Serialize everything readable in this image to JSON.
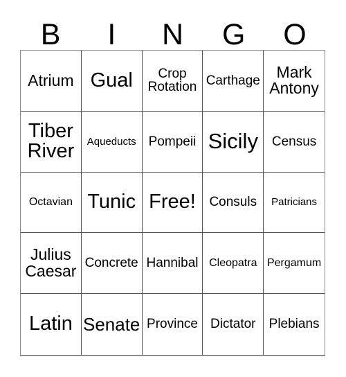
{
  "card": {
    "title_letters": [
      "B",
      "I",
      "N",
      "G",
      "O"
    ],
    "free_space_label": "Free!",
    "grid_line_color": "#555555",
    "border_color": "#8a8a8a",
    "text_color": "#000000",
    "background_color": "#ffffff",
    "columns": 5,
    "rows": 5,
    "cells": [
      {
        "text": "Atrium",
        "size": "sz-md"
      },
      {
        "text": "Gual",
        "size": "sz-lg"
      },
      {
        "text": "Crop Rotation",
        "size": "sz-sm"
      },
      {
        "text": "Carthage",
        "size": "sz-sm"
      },
      {
        "text": "Mark Antony",
        "size": "sz-md"
      },
      {
        "text": "Tiber River",
        "size": "sz-lg"
      },
      {
        "text": "Aqueducts",
        "size": "sz-xxs"
      },
      {
        "text": "Pompeii",
        "size": "sz-sm"
      },
      {
        "text": "Sicily",
        "size": "sz-xl"
      },
      {
        "text": "Census",
        "size": "sz-sm"
      },
      {
        "text": "Octavian",
        "size": "sz-xs"
      },
      {
        "text": "Tunic",
        "size": "sz-lg"
      },
      {
        "text": "Free!",
        "size": "sz-lg"
      },
      {
        "text": "Consuls",
        "size": "sz-sm"
      },
      {
        "text": "Patricians",
        "size": "sz-xxs"
      },
      {
        "text": "Julius Caesar",
        "size": "sz-md"
      },
      {
        "text": "Concrete",
        "size": "sz-sm"
      },
      {
        "text": "Hannibal",
        "size": "sz-sm"
      },
      {
        "text": "Cleopatra",
        "size": "sz-xs"
      },
      {
        "text": "Pergamum",
        "size": "sz-xs"
      },
      {
        "text": "Latin",
        "size": "sz-lg"
      },
      {
        "text": "Senate",
        "size": "sz-ml"
      },
      {
        "text": "Province",
        "size": "sz-sm"
      },
      {
        "text": "Dictator",
        "size": "sz-sm"
      },
      {
        "text": "Plebians",
        "size": "sz-sm"
      }
    ]
  }
}
